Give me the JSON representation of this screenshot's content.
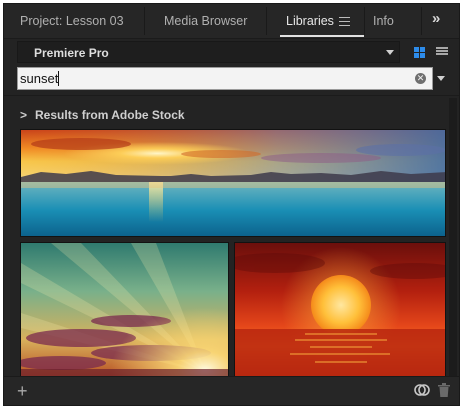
{
  "tabs": [
    {
      "label": "Project: Lesson 03",
      "active": false
    },
    {
      "label": "Media Browser",
      "active": false
    },
    {
      "label": "Libraries",
      "active": true,
      "icon": "panel-menu-icon"
    },
    {
      "label": "Info",
      "active": false
    }
  ],
  "overflow_label": "»",
  "library_select": {
    "value": "Premiere Pro",
    "icon": "chevron-down-icon"
  },
  "view_modes": {
    "grid_icon": "grid-view-icon",
    "list_icon": "list-view-icon",
    "active": "grid",
    "accent": "#2d8ceb"
  },
  "search": {
    "value": "sunset",
    "clear_icon": "clear-icon",
    "options_icon": "chevron-down-icon"
  },
  "results": {
    "header": "Results from Adobe Stock",
    "chevron_icon": "chevron-right-icon",
    "thumbnails": [
      {
        "name": "sunset-over-lagoon-panorama"
      },
      {
        "name": "sun-rays-through-clouds"
      },
      {
        "name": "red-sun-over-ocean"
      }
    ]
  },
  "footer": {
    "add_icon": "plus-icon",
    "sync_icon": "sync-icon",
    "trash_icon": "trash-icon"
  },
  "colors": {
    "panel_bg": "#232323",
    "text": "#e6e6e6",
    "muted_text": "#b0b0b0"
  }
}
